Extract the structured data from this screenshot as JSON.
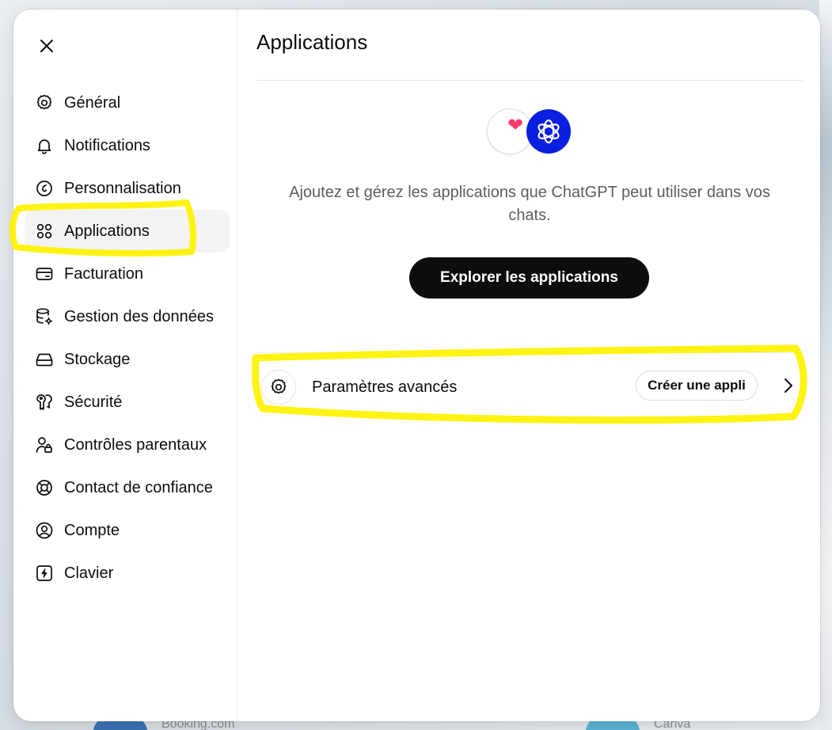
{
  "sidebar": {
    "close_icon": "close-icon",
    "items": [
      {
        "label": "Général",
        "icon": "gear-icon"
      },
      {
        "label": "Notifications",
        "icon": "bell-icon"
      },
      {
        "label": "Personnalisation",
        "icon": "personalization-icon"
      },
      {
        "label": "Applications",
        "icon": "apps-grid-icon",
        "active": true
      },
      {
        "label": "Facturation",
        "icon": "card-icon"
      },
      {
        "label": "Gestion des données",
        "icon": "database-gear-icon"
      },
      {
        "label": "Stockage",
        "icon": "storage-icon"
      },
      {
        "label": "Sécurité",
        "icon": "key-icon"
      },
      {
        "label": "Contrôles parentaux",
        "icon": "parent-lock-icon"
      },
      {
        "label": "Contact de confiance",
        "icon": "lifebuoy-icon"
      },
      {
        "label": "Compte",
        "icon": "user-circle-icon"
      },
      {
        "label": "Clavier",
        "icon": "keyboard-bolt-icon"
      }
    ]
  },
  "main": {
    "title": "Applications",
    "description": "Ajoutez et gérez les applications que ChatGPT peut utiliser dans vos chats.",
    "explore_button": "Explorer les applications",
    "advanced": {
      "label": "Paramètres avancés",
      "create_button": "Créer une appli"
    }
  },
  "background": {
    "left_label": "Booking.com",
    "right_label": "Canva"
  },
  "colors": {
    "accent_blue": "#0a1fe0",
    "heart_pink": "#ff3b6b",
    "highlighter": "#fff200",
    "button_dark": "#0d0d0d"
  }
}
